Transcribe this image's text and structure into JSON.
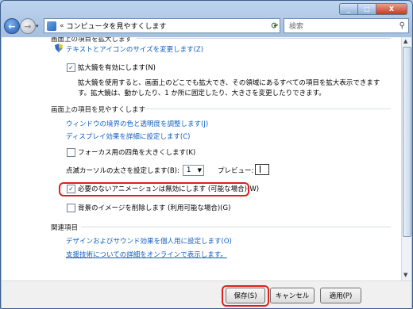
{
  "window": {
    "controls": {
      "minimize": "_",
      "maximize": "□",
      "close": "X"
    }
  },
  "navigation": {
    "back_glyph": "←",
    "forward_glyph": "→",
    "address_sep": "«",
    "address_path": "コンピュータを見やすくします",
    "search_placeholder": "検索"
  },
  "sections": {
    "zoom": {
      "heading": "画面上の項目を拡大します",
      "link_text_size": "テキストとアイコンのサイズを変更します(Z)",
      "magnifier_label": "拡大鏡を有効にします(N)",
      "magnifier_checked": true,
      "magnifier_desc_line1": "拡大鏡を使用すると、画面上のどこでも拡大でき、その領域にあるすべての項目を拡大表示できます",
      "magnifier_desc_line2": "す。拡大鏡は、動かしたり、1 か所に固定したり、大きさを変更したりできます。"
    },
    "visibility": {
      "heading": "画面上の項目を見やすくします",
      "link_border": "ウィンドウの境界の色と透明度を調整します(J)",
      "link_effects": "ディスプレイ効果を詳細に設定します(C)",
      "focus_label": "フォーカス用の四角を大きくします(K)",
      "focus_checked": false,
      "cursor_label": "点滅カーソルの太さを設定します(B):",
      "cursor_value": "1",
      "preview_label": "プレビュー:",
      "animation_label": "必要のないアニメーションは無効にします (可能な場合)(W)",
      "animation_checked": true,
      "background_label": "背景のイメージを削除します (利用可能な場合)(G)",
      "background_checked": false
    },
    "related": {
      "heading": "関連項目",
      "link_sound": "デザインおよびサウンド効果を個人用に設定します(O)",
      "link_online": "支援技術についての詳細をオンラインで表示します。"
    }
  },
  "footer": {
    "save": "保存(S)",
    "cancel": "キャンセル",
    "apply": "適用(P)"
  },
  "colors": {
    "link": "#0f5fc0",
    "highlight": "#e0201b"
  }
}
